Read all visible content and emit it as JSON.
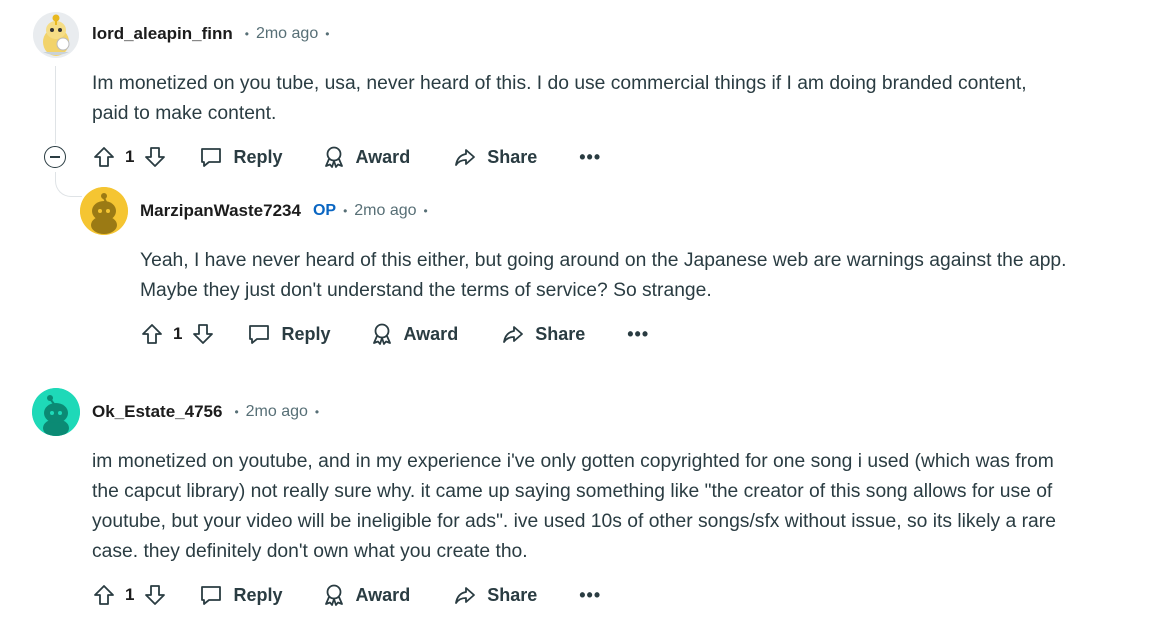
{
  "comments": [
    {
      "username": "lord_aleapin_finn",
      "time": "2mo ago",
      "body": [
        "Im monetized on you tube, usa, never heard of this. I do use commercial things if I am doing branded content,",
        "paid to make content."
      ],
      "votes": "1",
      "reply_label": "Reply",
      "award_label": "Award",
      "share_label": "Share",
      "more_label": "•••"
    },
    {
      "username": "MarzipanWaste7234",
      "op_badge": "OP",
      "time": "2mo ago",
      "body": [
        "Yeah, I have never heard of this either, but going around on the Japanese web are warnings against the app.",
        "Maybe they just don't understand the terms of service? So strange."
      ],
      "votes": "1",
      "reply_label": "Reply",
      "award_label": "Award",
      "share_label": "Share",
      "more_label": "•••"
    },
    {
      "username": "Ok_Estate_4756",
      "time": "2mo ago",
      "body": [
        "im monetized on youtube, and in my experience i've only gotten copyrighted for one song i used (which was from",
        "the capcut library) not really sure why. it came up saying something like \"the creator of this song allows for use of",
        "youtube, but your video will be ineligible for ads\". ive used 10s of other songs/sfx without issue, so its likely a rare",
        "case. they definitely don't own what you create tho."
      ],
      "votes": "1",
      "reply_label": "Reply",
      "award_label": "Award",
      "share_label": "Share",
      "more_label": "•••"
    }
  ],
  "separator": "•",
  "icons": {
    "upvote": "upvote-arrow-icon",
    "downvote": "downvote-arrow-icon",
    "reply": "speech-bubble-icon",
    "award": "award-ribbon-icon",
    "share": "share-arrow-icon",
    "collapse": "collapse-minus-icon"
  },
  "colors": {
    "op_badge": "#0a66c2",
    "avatar_yellow": "#f5c532",
    "avatar_teal": "#1ed9b8",
    "text": "#2a3c42",
    "meta": "#576f76"
  }
}
